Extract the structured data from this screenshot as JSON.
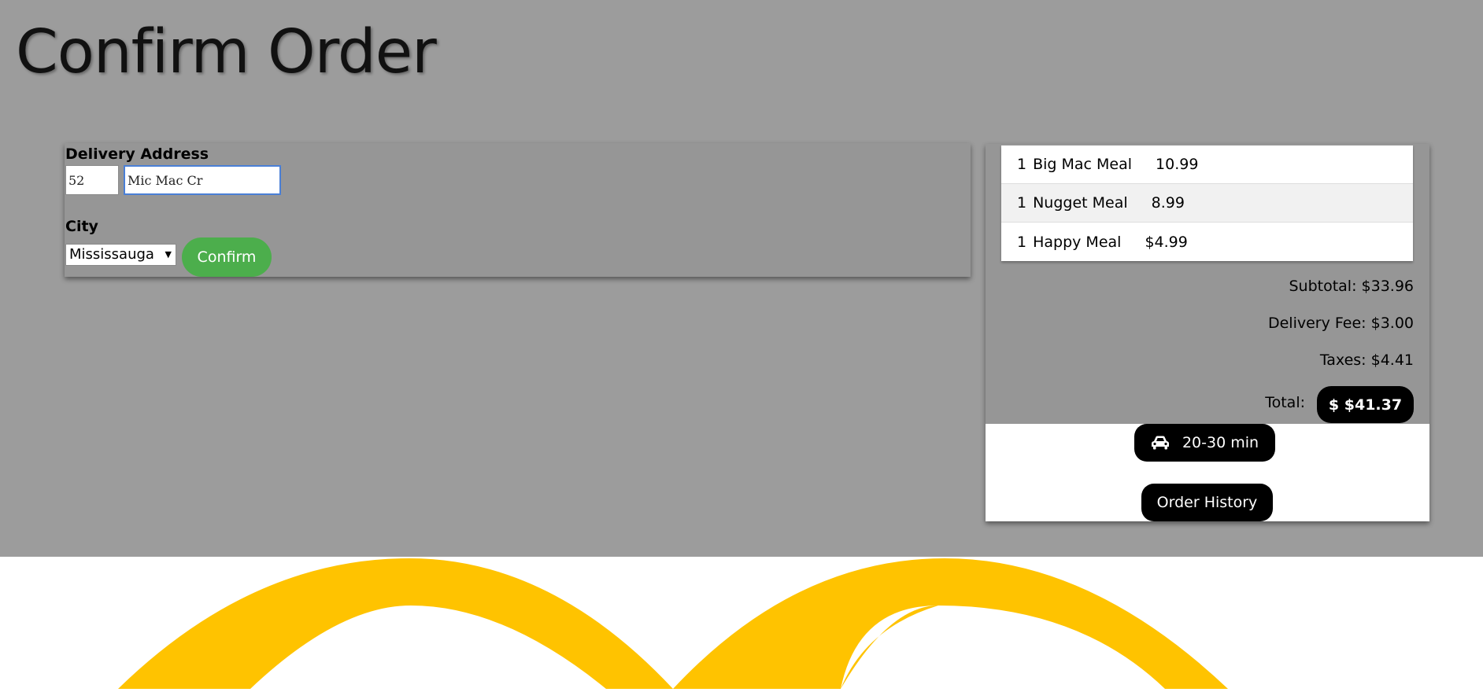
{
  "page": {
    "title": "Confirm Order"
  },
  "address": {
    "label": "Delivery Address",
    "street_number": "52",
    "street_name": "Mic Mac Cr",
    "city_label": "City",
    "city": "Mississauga",
    "confirm_label": "Confirm"
  },
  "order": {
    "items": [
      {
        "qty": "1",
        "name": "Big Mac Meal",
        "price": "10.99"
      },
      {
        "qty": "1",
        "name": "Nugget Meal",
        "price": "8.99"
      },
      {
        "qty": "1",
        "name": "Happy Meal",
        "price": "$4.99"
      }
    ],
    "subtotal": "Subtotal: $33.96",
    "delivery_fee": "Delivery Fee: $3.00",
    "taxes": "Taxes: $4.41",
    "total_label": "Total:",
    "total_value": "$ $41.37",
    "eta": "20-30 min",
    "history_label": "Order History"
  },
  "icons": {
    "eta": "car-icon",
    "logo": "golden-arches-logo"
  },
  "colors": {
    "background": "#9c9c9c",
    "confirm": "#4cae4c",
    "arches": "#ffc300",
    "pill": "#000000"
  }
}
